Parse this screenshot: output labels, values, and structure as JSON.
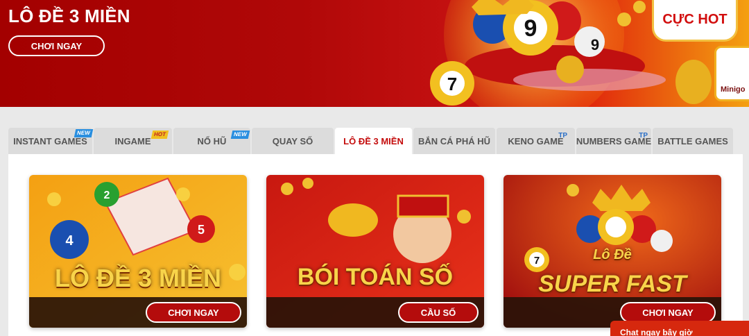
{
  "banner": {
    "title": "LÔ ĐỀ 3 MIỀN",
    "cta_label": "CHƠI NGAY",
    "hot_badge": "CỰC HOT",
    "minigame_label": "Minigo",
    "ball_numbers": [
      "9",
      "9",
      "7"
    ]
  },
  "tabs": [
    {
      "label": "INSTANT GAMES",
      "tag": "NEW"
    },
    {
      "label": "INGAME",
      "tag": "HOT"
    },
    {
      "label": "NỔ HŨ",
      "tag": "NEW"
    },
    {
      "label": "QUAY SỐ",
      "tag": ""
    },
    {
      "label": "LÔ ĐỀ 3 MIỀN",
      "tag": "",
      "active": true
    },
    {
      "label": "BẮN CÁ PHÁ HŨ",
      "tag": ""
    },
    {
      "label": "KENO GAME",
      "tag": "TP"
    },
    {
      "label": "NUMBERS GAME",
      "tag": "TP"
    },
    {
      "label": "BATTLE GAMES",
      "tag": ""
    }
  ],
  "cards": [
    {
      "title": "LÔ ĐỀ 3 MIỀN",
      "button": "CHƠI NGAY"
    },
    {
      "title": "BÓI TOÁN SỐ",
      "button": "CẦU SỐ"
    },
    {
      "title_small": "Lô Đề",
      "title": "SUPER FAST",
      "badge_number": "7",
      "button": "CHƠI NGAY"
    }
  ],
  "card1_balls": [
    "2",
    "4",
    "5"
  ],
  "chat_label": "Chat ngay bây giờ",
  "colors": {
    "brand_red": "#b40c0c",
    "active_tab_text": "#c40c0c",
    "gold_title": "#f8d44a",
    "new_tag": "#2a8fe0",
    "hot_tag": "#f0c020"
  }
}
